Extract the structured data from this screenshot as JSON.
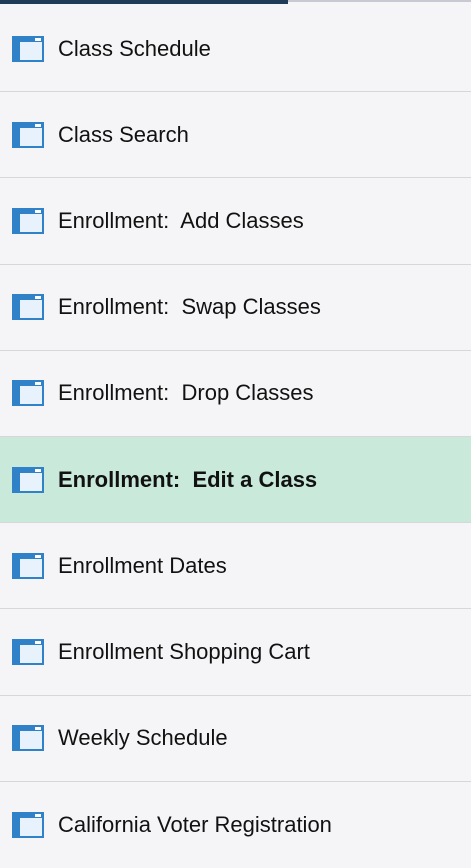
{
  "menu": {
    "items": [
      {
        "label": "Class Schedule",
        "icon": "window-icon",
        "selected": false
      },
      {
        "label": "Class Search",
        "icon": "window-icon",
        "selected": false
      },
      {
        "label": "Enrollment:  Add Classes",
        "icon": "window-icon",
        "selected": false
      },
      {
        "label": "Enrollment:  Swap Classes",
        "icon": "window-icon",
        "selected": false
      },
      {
        "label": "Enrollment:  Drop Classes",
        "icon": "window-icon",
        "selected": false
      },
      {
        "label": "Enrollment:  Edit a Class",
        "icon": "window-icon",
        "selected": true
      },
      {
        "label": "Enrollment Dates",
        "icon": "window-icon",
        "selected": false
      },
      {
        "label": "Enrollment Shopping Cart",
        "icon": "window-icon",
        "selected": false
      },
      {
        "label": "Weekly Schedule",
        "icon": "window-icon",
        "selected": false
      },
      {
        "label": "California Voter Registration",
        "icon": "window-icon",
        "selected": false
      }
    ]
  },
  "colors": {
    "selected_background": "#c9eadb",
    "row_background": "#f5f5f7",
    "icon_blue": "#2f82c7"
  }
}
